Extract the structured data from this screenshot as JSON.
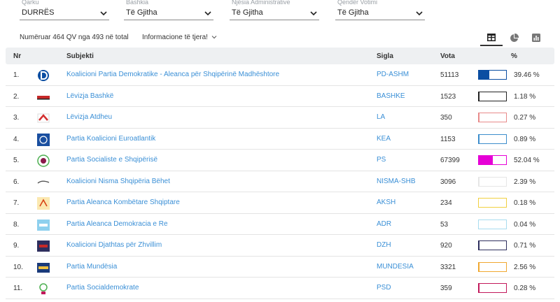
{
  "filters": [
    {
      "label": "Qarku",
      "value": "DURRËS"
    },
    {
      "label": "Bashkia",
      "value": "Të Gjitha"
    },
    {
      "label": "Njësia Administrative",
      "value": "Të Gjitha"
    },
    {
      "label": "Qendër Votimi",
      "value": "Të Gjitha"
    }
  ],
  "summary": "Numëruar 464 QV nga 493 në total",
  "more_info": "Informacione të tjera!",
  "views": [
    "table-icon",
    "pie-chart-icon",
    "bar-chart-icon"
  ],
  "table": {
    "headers": {
      "nr": "Nr",
      "subject": "Subjekti",
      "sigla": "Sigla",
      "vota": "Vota",
      "pct": "%"
    },
    "rows": [
      {
        "nr": "1.",
        "name": "Koalicioni Partia Demokratike - Aleanca për Shqipërinë Madhështore",
        "sigla": "PD-ASHM",
        "vota": "51113",
        "share": 39.46,
        "pct": "39.46 %",
        "color": "#0b4ea2",
        "logo": "pd-logo-icon"
      },
      {
        "nr": "2.",
        "name": "Lëvizja Bashkë",
        "sigla": "BASHKE",
        "vota": "1523",
        "share": 1.18,
        "pct": "1.18 %",
        "color": "#222222",
        "logo": "bashke-logo-icon"
      },
      {
        "nr": "3.",
        "name": "Lëvizja Atdheu",
        "sigla": "LA",
        "vota": "350",
        "share": 0.27,
        "pct": "0.27 %",
        "color": "#e88a8a",
        "logo": "atdheu-logo-icon"
      },
      {
        "nr": "4.",
        "name": "Partia Koalicioni Euroatlantik",
        "sigla": "KEA",
        "vota": "1153",
        "share": 0.89,
        "pct": "0.89 %",
        "color": "#3c8dcc",
        "logo": "kea-logo-icon"
      },
      {
        "nr": "5.",
        "name": "Partia Socialiste e Shqipërisë",
        "sigla": "PS",
        "vota": "67399",
        "share": 52.04,
        "pct": "52.04 %",
        "color": "#e600d6",
        "logo": "ps-logo-icon"
      },
      {
        "nr": "6.",
        "name": "Koalicioni Nisma Shqipëria Bëhet",
        "sigla": "NISMA-SHB",
        "vota": "3096",
        "share": 2.39,
        "pct": "2.39 %",
        "color": "#e6e6e6",
        "logo": "nisma-logo-icon"
      },
      {
        "nr": "7.",
        "name": "Partia Aleanca Kombëtare Shqiptare",
        "sigla": "AKSH",
        "vota": "234",
        "share": 0.18,
        "pct": "0.18 %",
        "color": "#f0d040",
        "logo": "aksh-logo-icon"
      },
      {
        "nr": "8.",
        "name": "Partia Aleanca Demokracia e Re",
        "sigla": "ADR",
        "vota": "53",
        "share": 0.04,
        "pct": "0.04 %",
        "color": "#a8dcef",
        "logo": "adr-logo-icon"
      },
      {
        "nr": "9.",
        "name": "Koalicioni Djathtas për Zhvillim",
        "sigla": "DZH",
        "vota": "920",
        "share": 0.71,
        "pct": "0.71 %",
        "color": "#2e2f5e",
        "logo": "dzh-logo-icon"
      },
      {
        "nr": "10.",
        "name": "Partia Mundësia",
        "sigla": "MUNDESIA",
        "vota": "3321",
        "share": 2.56,
        "pct": "2.56 %",
        "color": "#f0a830",
        "logo": "mundesia-logo-icon"
      },
      {
        "nr": "11.",
        "name": "Partia Socialdemokrate",
        "sigla": "PSD",
        "vota": "359",
        "share": 0.28,
        "pct": "0.28 %",
        "color": "#c2185b",
        "logo": "psd-logo-icon"
      }
    ]
  }
}
